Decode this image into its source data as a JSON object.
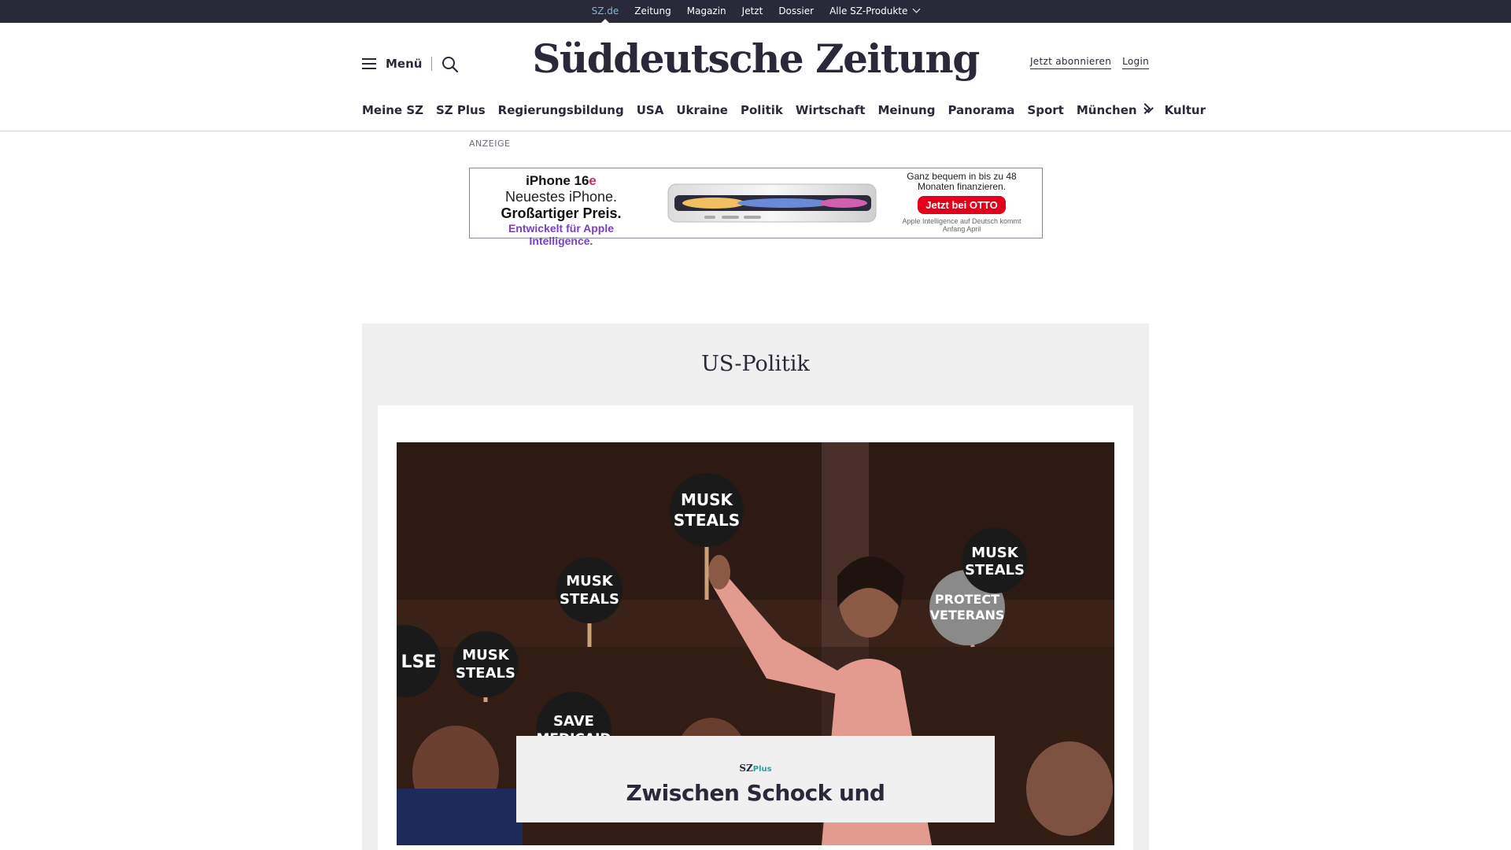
{
  "topbar": {
    "items": [
      "SZ.de",
      "Zeitung",
      "Magazin",
      "Jetzt",
      "Dossier",
      "Alle SZ-Produkte"
    ]
  },
  "header": {
    "menu_label": "Menü",
    "logo": "Süddeutsche Zeitung",
    "subscribe": "Jetzt abonnieren",
    "login": "Login"
  },
  "nav": {
    "items": [
      "Meine SZ",
      "SZ Plus",
      "Regierungsbildung",
      "USA",
      "Ukraine",
      "Politik",
      "Wirtschaft",
      "Meinung",
      "Panorama",
      "Sport",
      "München",
      "Kultur"
    ]
  },
  "ad": {
    "label": "ANZEIGE",
    "product": "iPhone 16",
    "product_suffix": "e",
    "line1": "Neuestes iPhone.",
    "line2": "Großartiger Preis.",
    "line3": "Entwickelt für Apple Intelligence.",
    "right_text": "Ganz bequem in bis zu 48 Monaten finanzieren.",
    "cta": "Jetzt bei OTTO",
    "footnote": "Apple Intelligence auf Deutsch kommt Anfang April"
  },
  "module": {
    "title": "US-Politik",
    "photo_signs": [
      "MUSK STEALS",
      "MUSK STEALS",
      "MUSK STEALS",
      "MUSK STEALS",
      "PROTECT VETERANS",
      "SAVE MEDICAID",
      "LSE"
    ],
    "brand": "SZ",
    "brand_plus": "Plus",
    "headline": "Zwischen Schock und"
  },
  "colors": {
    "topbar_bg": "#29293a",
    "active_link": "#7fb6d6",
    "module_bg": "#f0f0f0",
    "plus_teal": "#27a0a8",
    "otto_red": "#e2001a"
  }
}
